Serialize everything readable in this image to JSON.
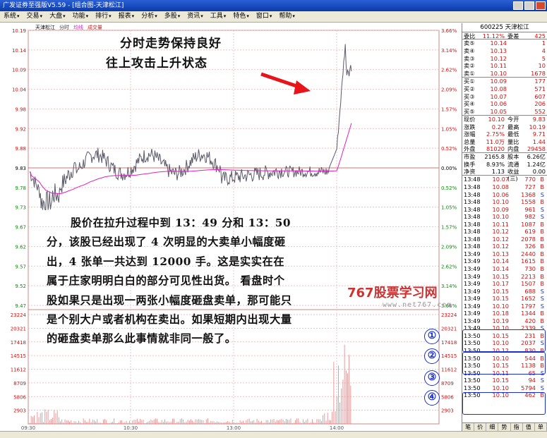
{
  "window": {
    "title": "广发证券至强版V5.59 - [组合图-天津松江]"
  },
  "menu": [
    "系统",
    "交易",
    "大盘",
    "功能",
    "排行",
    "报表",
    "分析",
    "多股",
    "资讯",
    "工具",
    "特色",
    "窗口",
    "帮助"
  ],
  "chart_header": {
    "stock": "天津松江",
    "series1": "分时",
    "series2": "均线",
    "series3": "成交量"
  },
  "price_axis": {
    "left": [
      "10.19",
      "10.14",
      "10.09",
      "10.04",
      "9.98",
      "9.92",
      "9.88",
      "9.83",
      "9.78",
      "9.73",
      "9.67",
      "9.62",
      "9.57",
      "9.52",
      "9.47"
    ],
    "right": [
      "3.66%",
      "3.14%",
      "2.62%",
      "2.09%",
      "1.57%",
      "1.05%",
      "0.52%",
      "0.00%",
      "0.52%",
      "1.05%",
      "1.57%",
      "2.09%",
      "2.62%",
      "3.14%",
      "3.66%"
    ]
  },
  "volume_axis": {
    "left": [
      "23224",
      "20321",
      "17418",
      "14515",
      "11612",
      "8709",
      "5806",
      "2903"
    ],
    "right": [
      "23224",
      "20321",
      "17418",
      "14515",
      "11612",
      "8709",
      "5806",
      "2903"
    ]
  },
  "time_axis": [
    "09:30",
    "10:30",
    "13:00",
    "14:00"
  ],
  "annotation_title": [
    "分时走势保持良好",
    "往上攻击上升状态"
  ],
  "annotation_body": "股价在拉升过程中到 13：49 分和 13：50 分，该股已经出现了 4 次明显的大卖单小幅度砸出，4 张单一共达到 12000 手。这是实实在在属于庄家明明白白的部分可见性出货。 看盘时个股如果只是出现一两张小幅度砸盘卖单，那可能只是个别大户或者机构在卖出。如果短期内出现大量的砸盘卖单那么此事情就非同一般了。",
  "watermark": {
    "brand": "767股票学习网",
    "site": "www.net767.com"
  },
  "markers": [
    "①",
    "②",
    "③",
    "④"
  ],
  "quote": {
    "code_header": "600225 天津松江",
    "weibi": {
      "label": "委比",
      "value": "11.12%",
      "label2": "委差",
      "value2": "425"
    },
    "asks": [
      {
        "label": "卖⑤",
        "price": "10.14",
        "vol": "1"
      },
      {
        "label": "卖④",
        "price": "10.13",
        "vol": "4"
      },
      {
        "label": "卖③",
        "price": "10.12",
        "vol": "5"
      },
      {
        "label": "卖②",
        "price": "10.11",
        "vol": "10"
      },
      {
        "label": "卖①",
        "price": "10.10",
        "vol": "1678"
      }
    ],
    "bids": [
      {
        "label": "买①",
        "price": "10.09",
        "vol": "177"
      },
      {
        "label": "买②",
        "price": "10.08",
        "vol": "571"
      },
      {
        "label": "买③",
        "price": "10.07",
        "vol": "607"
      },
      {
        "label": "买④",
        "price": "10.06",
        "vol": "206"
      },
      {
        "label": "买⑤",
        "price": "10.05",
        "vol": "552"
      }
    ],
    "stats": [
      {
        "k": "现价",
        "v": "10.10",
        "k2": "今开",
        "v2": "9.83"
      },
      {
        "k": "涨跌",
        "v": "0.27",
        "k2": "最高",
        "v2": "10.19"
      },
      {
        "k": "涨幅",
        "v": "2.75%",
        "k2": "最低",
        "v2": "9.71"
      },
      {
        "k": "总量",
        "v": "11.0万",
        "k2": "量比",
        "v2": "1.44"
      },
      {
        "k": "外盘",
        "v": "81020",
        "k2": "内盘",
        "v2": "29458"
      }
    ],
    "stats2": [
      {
        "k": "市盈",
        "v": "2165.8",
        "k2": "股本",
        "v2": "6.26亿"
      },
      {
        "k": "换手",
        "v": "8.93%",
        "k2": "流通",
        "v2": "1.24亿"
      },
      {
        "k": "净资",
        "v": "1.13",
        "k2": "收益(三)",
        "v2": "0.00"
      }
    ],
    "ticks": [
      {
        "t": "13:48",
        "p": "10.07",
        "v": "770",
        "f": "B"
      },
      {
        "t": "13:48",
        "p": "10.08",
        "v": "727",
        "f": "B"
      },
      {
        "t": "13:48",
        "p": "10.06",
        "v": "1368",
        "f": "S"
      },
      {
        "t": "13:48",
        "p": "10.10",
        "v": "1558",
        "f": "B"
      },
      {
        "t": "13:48",
        "p": "10.09",
        "v": "961",
        "f": "S"
      },
      {
        "t": "13:48",
        "p": "10.10",
        "v": "982",
        "f": "S"
      },
      {
        "t": "13:48",
        "p": "10.11",
        "v": "1087",
        "f": "B"
      },
      {
        "t": "13:48",
        "p": "10.12",
        "v": "619",
        "f": "B"
      },
      {
        "t": "13:48",
        "p": "10.12",
        "v": "2078",
        "f": "B"
      },
      {
        "t": "13:48",
        "p": "10.12",
        "v": "326",
        "f": "B"
      },
      {
        "t": "13:49",
        "p": "10.13",
        "v": "2440",
        "f": "B"
      },
      {
        "t": "13:49",
        "p": "10.14",
        "v": "1615",
        "f": "B"
      },
      {
        "t": "13:49",
        "p": "10.14",
        "v": "730",
        "f": "B"
      },
      {
        "t": "13:49",
        "p": "10.15",
        "v": "2213",
        "f": "B"
      },
      {
        "t": "13:49",
        "p": "10.17",
        "v": "1507",
        "f": "B"
      },
      {
        "t": "13:49",
        "p": "10.15",
        "v": "688",
        "f": "S"
      },
      {
        "t": "13:49",
        "p": "10.15",
        "v": "1652",
        "f": "S"
      },
      {
        "t": "13:49",
        "p": "10.10",
        "v": "1797",
        "f": "S"
      },
      {
        "t": "13:49",
        "p": "10.18",
        "v": "1344",
        "f": "B"
      },
      {
        "t": "13:49",
        "p": "10.19",
        "v": "420",
        "f": "B"
      },
      {
        "t": "13:49",
        "p": "10.10",
        "v": "2339",
        "f": "S"
      },
      {
        "t": "13:50",
        "p": "10.15",
        "v": "231",
        "f": "B"
      },
      {
        "t": "13:50",
        "p": "10.10",
        "v": "2037",
        "f": "S"
      },
      {
        "t": "13:50",
        "p": "10.12",
        "v": "830",
        "f": "B"
      },
      {
        "t": "13:50",
        "p": "10.10",
        "v": "544",
        "f": "B"
      },
      {
        "t": "13:50",
        "p": "10.15",
        "v": "1138",
        "f": "B"
      },
      {
        "t": "13:50",
        "p": "10.11",
        "v": "65",
        "f": "S"
      },
      {
        "t": "13:50",
        "p": "10.15",
        "v": "94",
        "f": "S"
      },
      {
        "t": "13:50",
        "p": "10.10",
        "v": "5794",
        "f": "S"
      },
      {
        "t": "13:50",
        "p": "10.10",
        "v": "462",
        "f": "B"
      }
    ],
    "bottom_tabs": [
      "笔",
      "价",
      "细",
      "势",
      "指",
      "值",
      "单"
    ]
  },
  "colors": {
    "price_line": "#5a5a6a",
    "avg_line": "#e020c0",
    "volume_bar": "#e08080",
    "grid_red": "#e8b0b0",
    "marker_blue": "#1a2fd0",
    "arrow": "#e8141a"
  }
}
